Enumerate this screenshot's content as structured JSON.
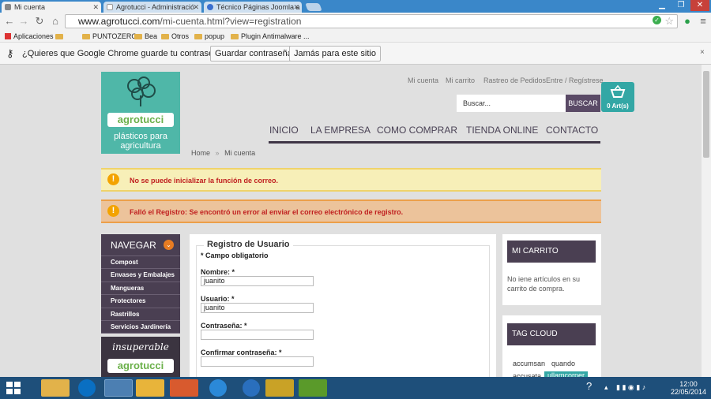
{
  "browser": {
    "tabs": [
      {
        "title": "Mi cuenta",
        "active": true
      },
      {
        "title": "Agrotucci - Administració",
        "active": false
      },
      {
        "title": "Técnico Páginas Joomla a",
        "active": false
      }
    ],
    "url_host": "www.agrotucci.com",
    "url_path": "/mi-cuenta.html?view=registration",
    "bookmarks": [
      {
        "label": "Aplicaciones",
        "icon": "apps-icon"
      },
      {
        "label": "",
        "icon": "folder-icon"
      },
      {
        "label": "PUNTOZERO",
        "icon": "folder-icon"
      },
      {
        "label": "Bea",
        "icon": "folder-icon"
      },
      {
        "label": "Otros",
        "icon": "folder-icon"
      },
      {
        "label": "popup",
        "icon": "folder-icon"
      },
      {
        "label": "Plugin Antimalware ...",
        "icon": "folder-icon"
      }
    ],
    "password_bar": {
      "message": "¿Quieres que Google Chrome guarde tu contraseña?",
      "save_label": "Guardar contraseña",
      "never_label": "Jamás para este sitio"
    }
  },
  "site": {
    "logo_brand": "agrotucci",
    "logo_tagline": "plásticos para agricultura",
    "top_links": [
      "Mi cuenta",
      "Mi carrito",
      "Rastreo de Pedidos",
      "Entre / Regístrese"
    ],
    "search_placeholder": "Buscar...",
    "search_button": "BUSCAR",
    "cart_count": "0 Art(s)",
    "main_nav": [
      "INICIO",
      "LA EMPRESA",
      "COMO COMPRAR",
      "TIENDA ONLINE",
      "CONTACTO"
    ],
    "breadcrumb": [
      "Home",
      "Mi cuenta"
    ],
    "alerts": [
      "No se puede inicializar la función de correo.",
      "Falló el Registro: Se encontró un error al enviar el correo electrónico de registro."
    ],
    "left_nav": {
      "title": "NAVEGAR",
      "items": [
        "Compost",
        "Envases y Embalajes",
        "Mangueras",
        "Protectores",
        "Rastrillos",
        "Servicios Jardinería"
      ]
    },
    "promo": {
      "line1": "insuperable",
      "line2": "agrotucci"
    },
    "form": {
      "legend": "Registro de Usuario",
      "required_note": "* Campo obligatorio",
      "fields": [
        {
          "label": "Nombre: *",
          "value": "juanito"
        },
        {
          "label": "Usuario: *",
          "value": "juanito"
        },
        {
          "label": "Contraseña: *",
          "value": ""
        },
        {
          "label": "Confirmar contraseña: *",
          "value": ""
        }
      ]
    },
    "cart_box": {
      "title": "MI CARRITO",
      "body": "No iene artículos en su carrito de compra."
    },
    "tag_cloud": {
      "title": "TAG CLOUD",
      "tags": [
        "accumsan",
        "quando",
        "accusata",
        "ullamcorper"
      ]
    }
  },
  "taskbar": {
    "time": "12:00",
    "date": "22/05/2014"
  }
}
